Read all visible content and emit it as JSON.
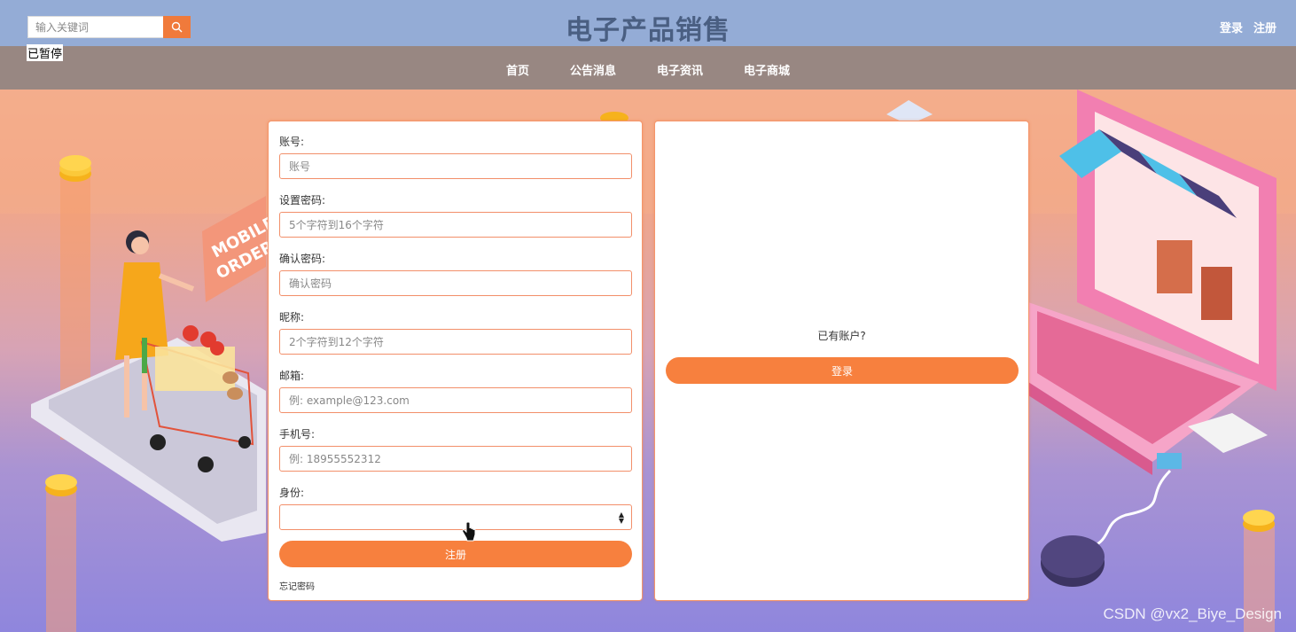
{
  "header": {
    "search_placeholder": "输入关键词",
    "site_title": "电子产品销售",
    "login_link": "登录",
    "register_link": "注册",
    "paused_label": "已暂停"
  },
  "nav": {
    "items": [
      {
        "label": "首页"
      },
      {
        "label": "公告消息"
      },
      {
        "label": "电子资讯"
      },
      {
        "label": "电子商城"
      }
    ]
  },
  "register_form": {
    "account_label": "账号:",
    "account_placeholder": "账号",
    "password_label": "设置密码:",
    "password_placeholder": "5个字符到16个字符",
    "confirm_label": "确认密码:",
    "confirm_placeholder": "确认密码",
    "nickname_label": "昵称:",
    "nickname_placeholder": "2个字符到12个字符",
    "email_label": "邮箱:",
    "email_placeholder": "例: example@123.com",
    "phone_label": "手机号:",
    "phone_placeholder": "例: 18955552312",
    "identity_label": "身份:",
    "identity_value": "",
    "submit_label": "注册",
    "forgot_label": "忘记密码"
  },
  "login_panel": {
    "has_account_text": "已有账户?",
    "login_button": "登录"
  },
  "illustration": {
    "sign_text_line1": "MOBILE",
    "sign_text_line2": "ORDER"
  },
  "watermark": "CSDN @vx2_Biye_Design",
  "colors": {
    "topbar": "#94acd6",
    "navbar": "#988782",
    "accent": "#f7803e",
    "title": "#4a5f82"
  },
  "icons": {
    "search": "search-icon",
    "select": "select-arrows-icon",
    "cursor": "hand-pointer-icon"
  }
}
